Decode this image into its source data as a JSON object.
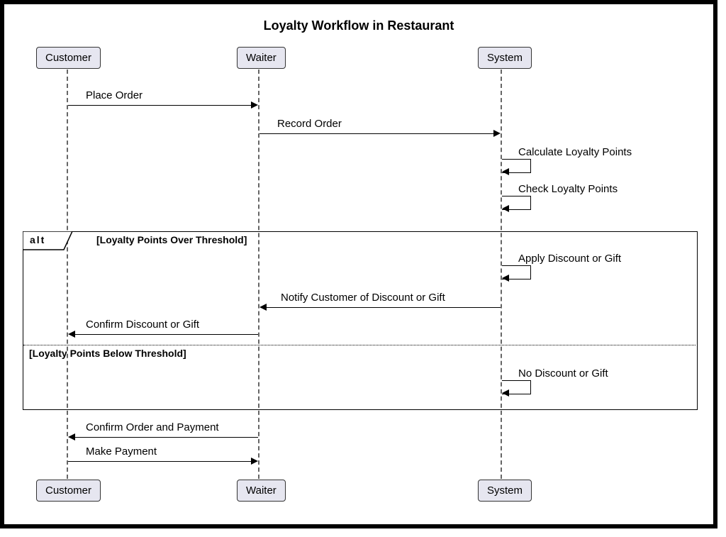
{
  "title": "Loyalty Workflow in Restaurant",
  "participants": {
    "customer": "Customer",
    "waiter": "Waiter",
    "system": "System"
  },
  "messages": {
    "placeOrder": "Place Order",
    "recordOrder": "Record Order",
    "calcPoints": "Calculate Loyalty Points",
    "checkPoints": "Check Loyalty Points",
    "applyDiscount": "Apply Discount or Gift",
    "notifyCustomer": "Notify Customer of Discount or Gift",
    "confirmDiscount": "Confirm Discount or Gift",
    "noDiscount": "No Discount or Gift",
    "confirmOrder": "Confirm Order and Payment",
    "makePayment": "Make Payment"
  },
  "alt": {
    "label": "alt",
    "guard1": "[Loyalty Points Over Threshold]",
    "guard2": "[Loyalty Points Below Threshold]"
  }
}
